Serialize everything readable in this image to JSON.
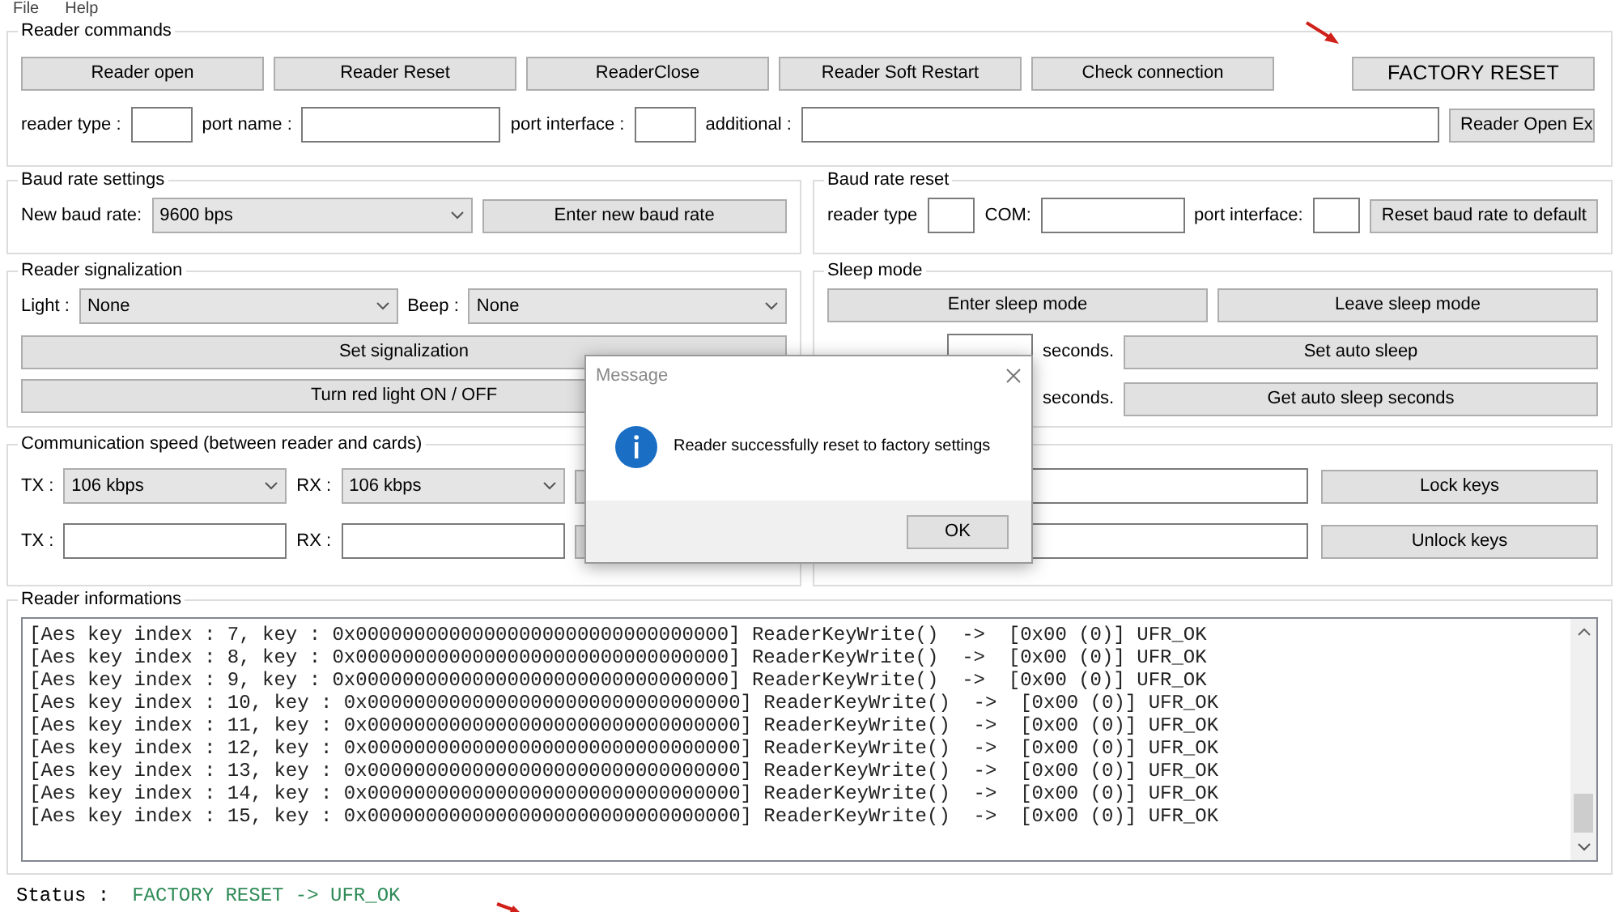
{
  "menu": [
    {
      "label": "File"
    },
    {
      "label": "Help"
    }
  ],
  "reader_commands": {
    "title": "Reader commands",
    "buttons": [
      "Reader open",
      "Reader Reset",
      "ReaderClose",
      "Reader Soft Restart",
      "Check connection"
    ],
    "factory_button": "FACTORY RESET",
    "fields": [
      {
        "label": "reader type :"
      },
      {
        "label": "port name :"
      },
      {
        "label": "port interface :"
      },
      {
        "label": "additional :"
      }
    ],
    "open_ex_button": "Reader Open Ex"
  },
  "baud_rate_settings": {
    "title": "Baud rate settings",
    "label": "New baud rate:",
    "value": "9600 bps",
    "button": "Enter new baud rate"
  },
  "baud_rate_reset": {
    "title": "Baud rate reset",
    "fields": [
      {
        "label": "reader type"
      },
      {
        "label": "COM:"
      },
      {
        "label": "port interface:"
      }
    ],
    "button": "Reset baud rate to default"
  },
  "reader_signalization": {
    "title": "Reader signalization",
    "selects": [
      {
        "label": "Light :",
        "value": "None"
      },
      {
        "label": "Beep :",
        "value": "None"
      }
    ],
    "buttons": [
      "Set signalization",
      "Turn red light ON / OFF"
    ]
  },
  "sleep_mode": {
    "title": "Sleep mode",
    "buttons": [
      "Enter sleep mode",
      "Leave sleep mode"
    ],
    "rows": [
      {
        "unit": "seconds.",
        "button": "Set auto sleep"
      },
      {
        "unit": "seconds.",
        "button": "Get auto sleep seconds"
      }
    ]
  },
  "communication_speed": {
    "title": "Communication speed (between reader and cards)",
    "selects": [
      {
        "label": "TX :",
        "value": "106 kbps"
      },
      {
        "label": "RX :",
        "value": "106 kbps"
      }
    ],
    "fields": [
      {
        "label": "TX :"
      },
      {
        "label": "RX :"
      }
    ]
  },
  "key_lock": {
    "buttons": [
      "Lock keys",
      "Unlock keys"
    ]
  },
  "reader_informations": {
    "title": "Reader informations",
    "lines": [
      "[Aes key index : 7, key : 0x00000000000000000000000000000000] ReaderKeyWrite()  ->  [0x00 (0)] UFR_OK",
      "[Aes key index : 8, key : 0x00000000000000000000000000000000] ReaderKeyWrite()  ->  [0x00 (0)] UFR_OK",
      "[Aes key index : 9, key : 0x00000000000000000000000000000000] ReaderKeyWrite()  ->  [0x00 (0)] UFR_OK",
      "[Aes key index : 10, key : 0x00000000000000000000000000000000] ReaderKeyWrite()  ->  [0x00 (0)] UFR_OK",
      "[Aes key index : 11, key : 0x00000000000000000000000000000000] ReaderKeyWrite()  ->  [0x00 (0)] UFR_OK",
      "[Aes key index : 12, key : 0x00000000000000000000000000000000] ReaderKeyWrite()  ->  [0x00 (0)] UFR_OK",
      "[Aes key index : 13, key : 0x00000000000000000000000000000000] ReaderKeyWrite()  ->  [0x00 (0)] UFR_OK",
      "[Aes key index : 14, key : 0x00000000000000000000000000000000] ReaderKeyWrite()  ->  [0x00 (0)] UFR_OK",
      "[Aes key index : 15, key : 0x00000000000000000000000000000000] ReaderKeyWrite()  ->  [0x00 (0)] UFR_OK"
    ]
  },
  "status": {
    "label": "Status :",
    "value": "FACTORY RESET -> UFR_OK"
  },
  "dialog": {
    "title": "Message",
    "text": "Reader successfully reset to factory settings",
    "button": "OK"
  }
}
